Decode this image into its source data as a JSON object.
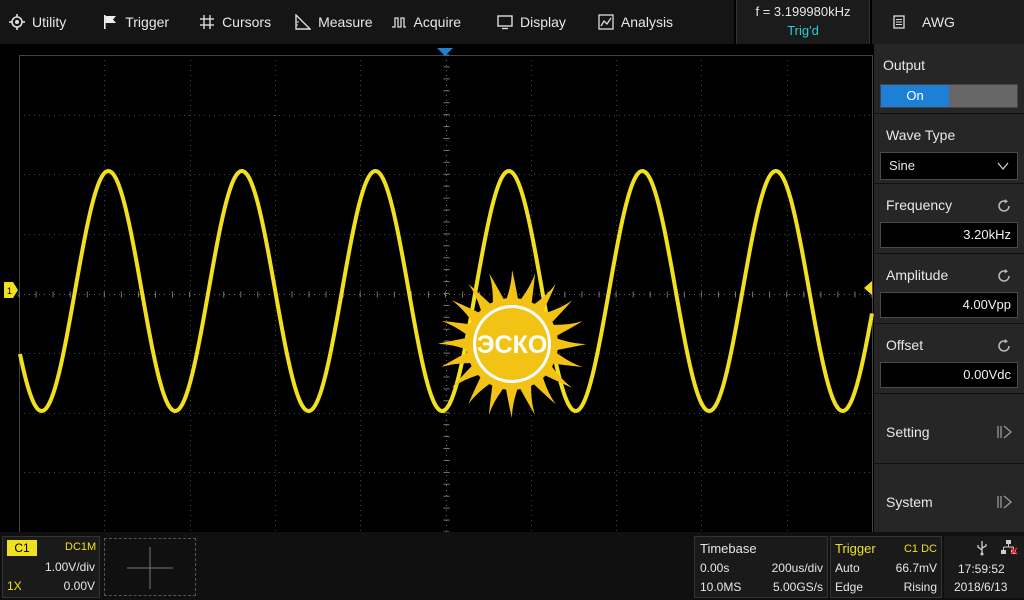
{
  "menu": {
    "items": [
      {
        "label": "Utility",
        "icon": "gear-icon"
      },
      {
        "label": "Trigger",
        "icon": "flag-icon"
      },
      {
        "label": "Cursors",
        "icon": "crosshair-icon"
      },
      {
        "label": "Measure",
        "icon": "ruler-icon"
      },
      {
        "label": "Acquire",
        "icon": "pulse-icon"
      },
      {
        "label": "Display",
        "icon": "monitor-icon"
      },
      {
        "label": "Analysis",
        "icon": "chart-icon"
      }
    ]
  },
  "status": {
    "frequency": "f = 3.199980kHz",
    "trigger_state": "Trig'd"
  },
  "awg": {
    "title": "AWG",
    "output_label": "Output",
    "output_value": "On",
    "wave_type_label": "Wave Type",
    "wave_type_value": "Sine",
    "frequency_label": "Frequency",
    "frequency_value": "3.20kHz",
    "amplitude_label": "Amplitude",
    "amplitude_value": "4.00Vpp",
    "offset_label": "Offset",
    "offset_value": "0.00Vdc",
    "setting_label": "Setting",
    "system_label": "System"
  },
  "channel": {
    "name": "C1",
    "coupling": "DC1M",
    "scale": "1.00V/div",
    "probe": "1X",
    "offset": "0.00V",
    "marker": "1"
  },
  "timebase": {
    "title": "Timebase",
    "delay": "0.00s",
    "scale": "200us/div",
    "memory": "10.0MS",
    "sample_rate": "5.00GS/s"
  },
  "trigger": {
    "title": "Trigger",
    "source": "C1 DC",
    "mode": "Auto",
    "level": "66.7mV",
    "type": "Edge",
    "slope": "Rising"
  },
  "clock": {
    "time": "17:59:52",
    "date": "2018/6/13"
  },
  "logo": {
    "text": "ЭСКО"
  },
  "colors": {
    "trace": "#f0e020",
    "accent": "#1e7fd6",
    "trig_state": "#1fd3d3"
  }
}
